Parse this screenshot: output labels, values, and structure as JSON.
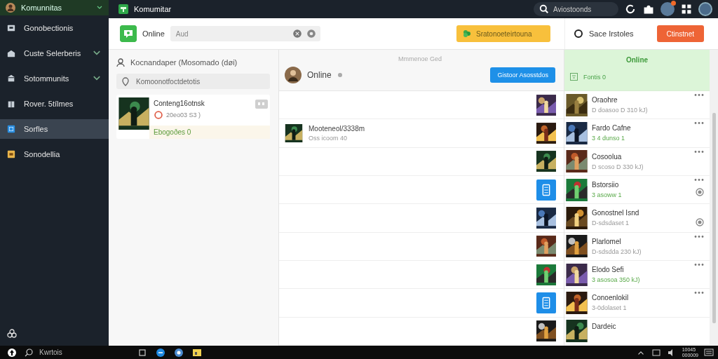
{
  "sidebar": {
    "header": {
      "title": "Komunnitas",
      "expanded": true
    },
    "items": [
      {
        "label": "Gonobectionis",
        "expandable": false,
        "selected": false
      },
      {
        "label": "Custe Selerberis",
        "expandable": true,
        "selected": false
      },
      {
        "label": "Sotommunits",
        "expandable": true,
        "selected": false
      },
      {
        "label": "Rover. 5tílmes",
        "expandable": false,
        "selected": false
      },
      {
        "label": "Sorfles",
        "expandable": false,
        "selected": true
      },
      {
        "label": "Sonodellia",
        "expandable": false,
        "selected": false
      }
    ]
  },
  "topbar": {
    "title": "Komumitar",
    "search": {
      "placeholder": "Aviostoonds"
    },
    "notification": true
  },
  "header": {
    "label": "Online",
    "search": {
      "value": "Aud"
    },
    "primary_button": "Sratonoeteirtouna",
    "status_label": "Sace Irstoles",
    "action_button": "Ctinstnet"
  },
  "left_panel": {
    "heading": "Kocnandaper (Mosomado (døi)",
    "search": {
      "placeholder": "Komoonotfoctdetotis"
    },
    "card": {
      "title": "Conteng16otnsk",
      "subtitle": "20eo03 S3 )",
      "footer": "Ebogoðes 0"
    }
  },
  "middle_panel": {
    "caption": "Mmmenoe Ged",
    "status": "Online",
    "button": "Gistoor Asosstdos",
    "rows": [
      {
        "kind": "picture"
      },
      {
        "kind": "picture",
        "title": "Mooteneol/3338m",
        "subtitle": "Oss icoom 40"
      },
      {
        "kind": "picture"
      },
      {
        "kind": "tile"
      },
      {
        "kind": "picture"
      },
      {
        "kind": "picture"
      },
      {
        "kind": "picture"
      },
      {
        "kind": "tile"
      },
      {
        "kind": "picture"
      }
    ]
  },
  "right_panel": {
    "header": "Online",
    "filter": "Fontis 0",
    "games": [
      {
        "title": "Oraohre",
        "subtitle": "D doasoo D 310 kJ)",
        "online": false,
        "menu": true,
        "toggle": false
      },
      {
        "title": "Fardo Cafne",
        "subtitle": "3 4 dunso 1",
        "online": true,
        "menu": true,
        "toggle": false
      },
      {
        "title": "Cosoolua",
        "subtitle": "D scoso D 330 kJ)",
        "online": false,
        "menu": true,
        "toggle": false
      },
      {
        "title": "Bstorsiio",
        "subtitle": "3 asoww 1",
        "online": true,
        "menu": true,
        "toggle": true
      },
      {
        "title": "Gonostnel Isnd",
        "subtitle": "D-sdsdaset 1",
        "online": false,
        "menu": false,
        "toggle": true
      },
      {
        "title": "Plarlomel",
        "subtitle": "D-sdsdda 230 kJ)",
        "online": false,
        "menu": true,
        "toggle": false
      },
      {
        "title": "Elodo Sefi",
        "subtitle": "3 asosoa 350 kJ)",
        "online": true,
        "menu": true,
        "toggle": false
      },
      {
        "title": "Conoenlokil",
        "subtitle": "3-0dolaset 1",
        "online": false,
        "menu": true,
        "toggle": false
      },
      {
        "title": "Dardeic",
        "menu": false,
        "toggle": false
      }
    ]
  },
  "taskbar": {
    "search": {
      "placeholder": "Kwrtois"
    },
    "clock": [
      "10045",
      "000009"
    ]
  }
}
